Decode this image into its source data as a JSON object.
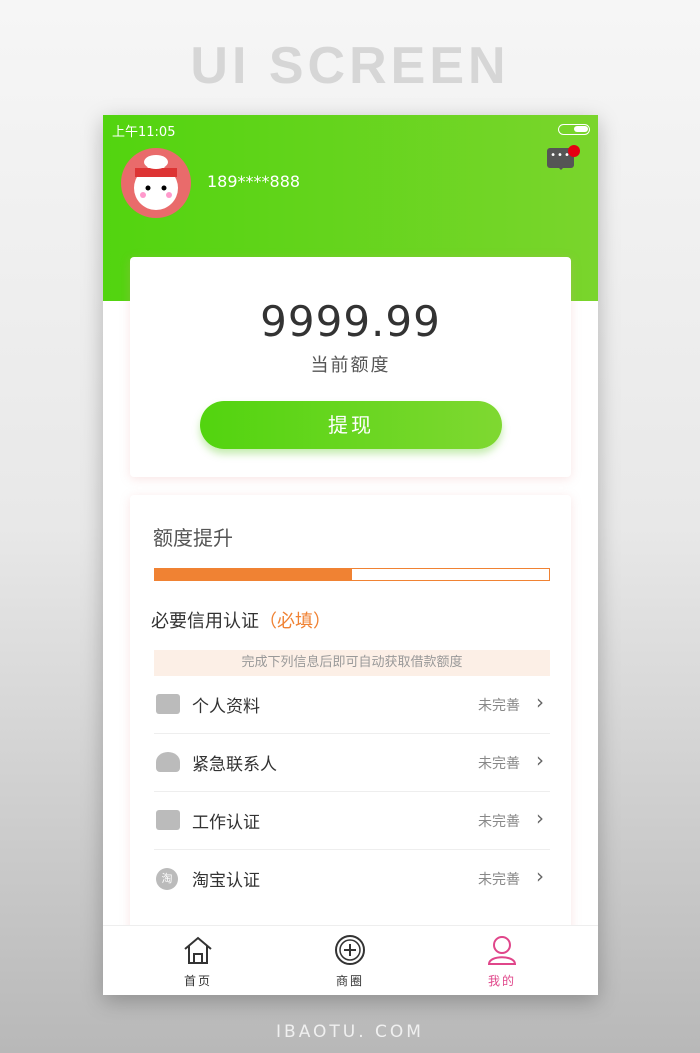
{
  "page": {
    "title": "UI SCREEN",
    "footer": "IBAOTU. COM"
  },
  "status_bar": {
    "time": "上午11:05"
  },
  "profile": {
    "phone": "189****888",
    "message_icon": "chat-bubble-icon",
    "badge_color": "#e60012"
  },
  "balance": {
    "amount": "9999.99",
    "label": "当前额度",
    "withdraw_label": "提现"
  },
  "credit": {
    "title": "额度提升",
    "progress_percent": 50,
    "required_title": "必要信用认证",
    "required_tag": "（必填）",
    "notice": "完成下列信息后即可自动获取借款额度",
    "items": [
      {
        "label": "个人资料",
        "status": "未完善",
        "icon": "id-card-icon"
      },
      {
        "label": "紧急联系人",
        "status": "未完善",
        "icon": "contact-person-icon"
      },
      {
        "label": "工作认证",
        "status": "未完善",
        "icon": "briefcase-icon"
      },
      {
        "label": "淘宝认证",
        "status": "未完善",
        "icon": "taobao-icon",
        "icon_text": "淘"
      }
    ]
  },
  "tabs": [
    {
      "label": "首页",
      "active": false
    },
    {
      "label": "商圈",
      "active": false
    },
    {
      "label": "我的",
      "active": true
    }
  ],
  "colors": {
    "brand_green": "#52d40f",
    "accent_orange": "#f08233",
    "active_tab": "#e0468a"
  }
}
